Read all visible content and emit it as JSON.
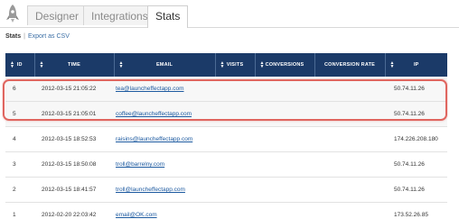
{
  "tabs": [
    {
      "label": "Designer",
      "active": false
    },
    {
      "label": "Integrations",
      "active": false
    },
    {
      "label": "Stats",
      "active": true
    }
  ],
  "subnav": {
    "current": "Stats",
    "separator": "|",
    "export_link": "Export as CSV"
  },
  "table": {
    "headers": [
      "ID",
      "TIME",
      "EMAIL",
      "VISITS",
      "CONVERSIONS",
      "CONVERSION RATE",
      "IP"
    ],
    "rows": [
      {
        "id": "6",
        "time": "2012-03-15 21:05:22",
        "email": "tea@launcheffectapp.com",
        "visits": "",
        "conversions": "",
        "rate": "",
        "ip": "50.74.11.26"
      },
      {
        "id": "5",
        "time": "2012-03-15 21:05:01",
        "email": "coffee@launcheffectapp.com",
        "visits": "",
        "conversions": "",
        "rate": "",
        "ip": "50.74.11.26"
      },
      {
        "id": "4",
        "time": "2012-03-15 18:52:53",
        "email": "raisins@launcheffectapp.com",
        "visits": "",
        "conversions": "",
        "rate": "",
        "ip": "174.226.208.180"
      },
      {
        "id": "3",
        "time": "2012-03-15 18:50:08",
        "email": "troll@barrelny.com",
        "visits": "",
        "conversions": "",
        "rate": "",
        "ip": "50.74.11.26"
      },
      {
        "id": "2",
        "time": "2012-03-15 18:41:57",
        "email": "troll@launcheffectapp.com",
        "visits": "",
        "conversions": "",
        "rate": "",
        "ip": "50.74.11.26"
      },
      {
        "id": "1",
        "time": "2012-02-20 22:03:42",
        "email": "email@OK.com",
        "visits": "",
        "conversions": "",
        "rate": "",
        "ip": "173.52.26.85"
      }
    ]
  },
  "colors": {
    "header_bg": "#1b3a68",
    "link": "#1d5aa0",
    "highlight_ring": "#e0655f"
  },
  "icons": {
    "logo": "rocket-logo-icon",
    "sort": "sort-arrows-icon"
  }
}
